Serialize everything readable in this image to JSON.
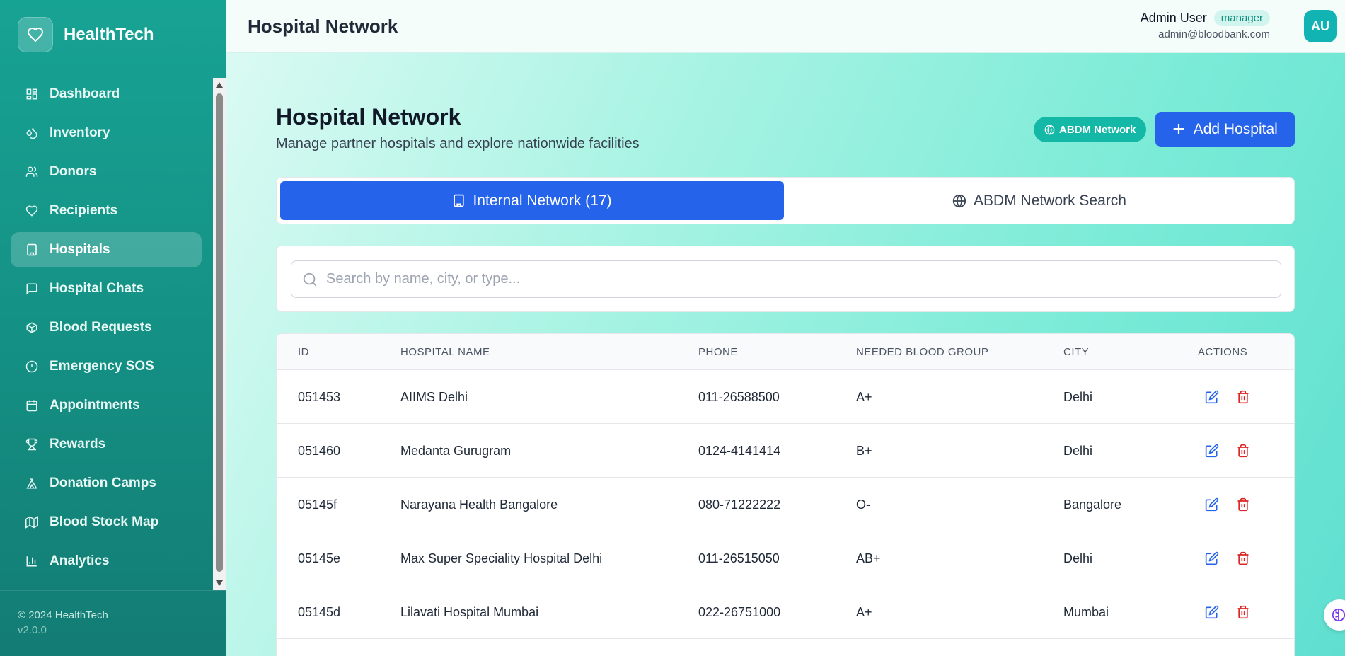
{
  "brand": {
    "name": "HealthTech"
  },
  "sidebar": {
    "items": [
      {
        "label": "Dashboard",
        "icon": "dashboard-icon",
        "active": false
      },
      {
        "label": "Inventory",
        "icon": "droplets-icon",
        "active": false
      },
      {
        "label": "Donors",
        "icon": "users-icon",
        "active": false
      },
      {
        "label": "Recipients",
        "icon": "heart-icon",
        "active": false
      },
      {
        "label": "Hospitals",
        "icon": "hospital-icon",
        "active": true
      },
      {
        "label": "Hospital Chats",
        "icon": "chat-icon",
        "active": false
      },
      {
        "label": "Blood Requests",
        "icon": "package-icon",
        "active": false
      },
      {
        "label": "Emergency SOS",
        "icon": "alert-icon",
        "active": false
      },
      {
        "label": "Appointments",
        "icon": "calendar-icon",
        "active": false
      },
      {
        "label": "Rewards",
        "icon": "trophy-icon",
        "active": false
      },
      {
        "label": "Donation Camps",
        "icon": "tent-icon",
        "active": false
      },
      {
        "label": "Blood Stock Map",
        "icon": "map-icon",
        "active": false
      },
      {
        "label": "Analytics",
        "icon": "bar-chart-icon",
        "active": false
      }
    ],
    "footer": {
      "copyright": "© 2024 HealthTech",
      "version": "v2.0.0"
    }
  },
  "header": {
    "title": "Hospital Network",
    "user": {
      "name": "Admin User",
      "role": "manager",
      "email": "admin@bloodbank.com",
      "initials": "AU"
    }
  },
  "main": {
    "title": "Hospital Network",
    "subtitle": "Manage partner hospitals and explore nationwide facilities",
    "abdm_badge": "ABDM Network",
    "add_button": "Add Hospital",
    "tabs": [
      {
        "label": "Internal Network (17)",
        "active": true
      },
      {
        "label": "ABDM Network Search",
        "active": false
      }
    ],
    "search": {
      "placeholder": "Search by name, city, or type...",
      "value": ""
    },
    "table": {
      "columns": [
        "ID",
        "HOSPITAL NAME",
        "PHONE",
        "NEEDED BLOOD GROUP",
        "CITY",
        "ACTIONS"
      ],
      "rows": [
        {
          "id": "051453",
          "name": "AIIMS Delhi",
          "phone": "011-26588500",
          "blood_group": "A+",
          "city": "Delhi"
        },
        {
          "id": "051460",
          "name": "Medanta Gurugram",
          "phone": "0124-4141414",
          "blood_group": "B+",
          "city": "Delhi"
        },
        {
          "id": "05145f",
          "name": "Narayana Health Bangalore",
          "phone": "080-71222222",
          "blood_group": "O-",
          "city": "Bangalore"
        },
        {
          "id": "05145e",
          "name": "Max Super Speciality Hospital Delhi",
          "phone": "011-26515050",
          "blood_group": "AB+",
          "city": "Delhi"
        },
        {
          "id": "05145d",
          "name": "Lilavati Hospital Mumbai",
          "phone": "022-26751000",
          "blood_group": "A+",
          "city": "Mumbai"
        }
      ]
    }
  },
  "colors": {
    "primary": "#2563eb",
    "teal": "#14b8a6",
    "danger": "#dc2626",
    "sidebar": "#17a394"
  }
}
